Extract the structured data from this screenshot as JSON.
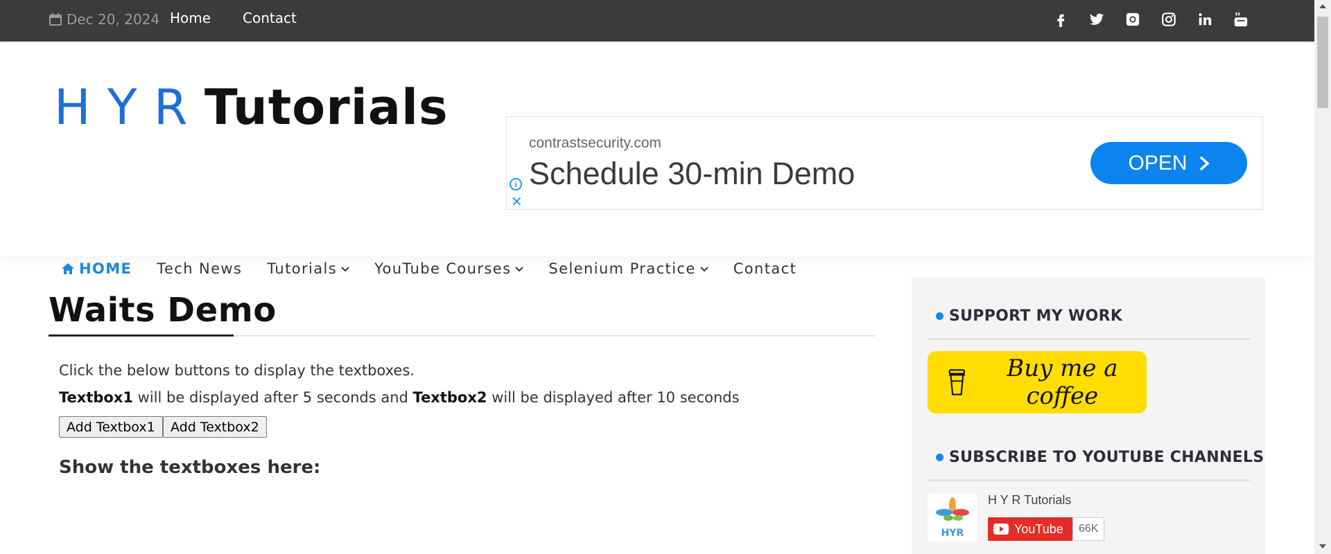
{
  "topbar": {
    "date": "Dec 20, 2024",
    "links": [
      "Home",
      "Contact"
    ],
    "social_icons": [
      "facebook-icon",
      "twitter-icon",
      "github-icon",
      "instagram-icon",
      "linkedin-icon",
      "youtube-icon"
    ]
  },
  "header": {
    "logo_part1": "H Y R",
    "logo_part2": "Tutorials"
  },
  "ad": {
    "domain": "contrastsecurity.com",
    "headline": "Schedule 30-min Demo",
    "open_label": "OPEN",
    "info_symbol": "i",
    "close_symbol": "✕"
  },
  "nav": {
    "items": [
      "HOME",
      "Tech News",
      "Tutorials",
      "YouTube Courses",
      "Selenium Practice",
      "Contact"
    ]
  },
  "main": {
    "title": "Waits Demo",
    "para1": "Click the below buttons to display the textboxes.",
    "para2": {
      "b1": "Textbox1",
      "t1": " will be displayed after 5 seconds and ",
      "b2": "Textbox2",
      "t2": " will be displayed after 10 seconds"
    },
    "button1": "Add Textbox1",
    "button2": "Add Textbox2",
    "show_title": "Show the textboxes here:"
  },
  "sidebar": {
    "support_title": "SUPPORT MY WORK",
    "coffee_label": "Buy me a coffee",
    "subscribe_title": "SUBSCRIBE TO YOUTUBE CHANNELS",
    "channel_name": "H Y R Tutorials",
    "youtube_label": "YouTube",
    "subscriber_count": "66K",
    "channel_logo_text": "HYR"
  },
  "colors": {
    "accent": "#1a87e6",
    "topbar": "#3b3b3b",
    "coffee": "#ffdd00",
    "youtube_red": "#e52d27"
  }
}
